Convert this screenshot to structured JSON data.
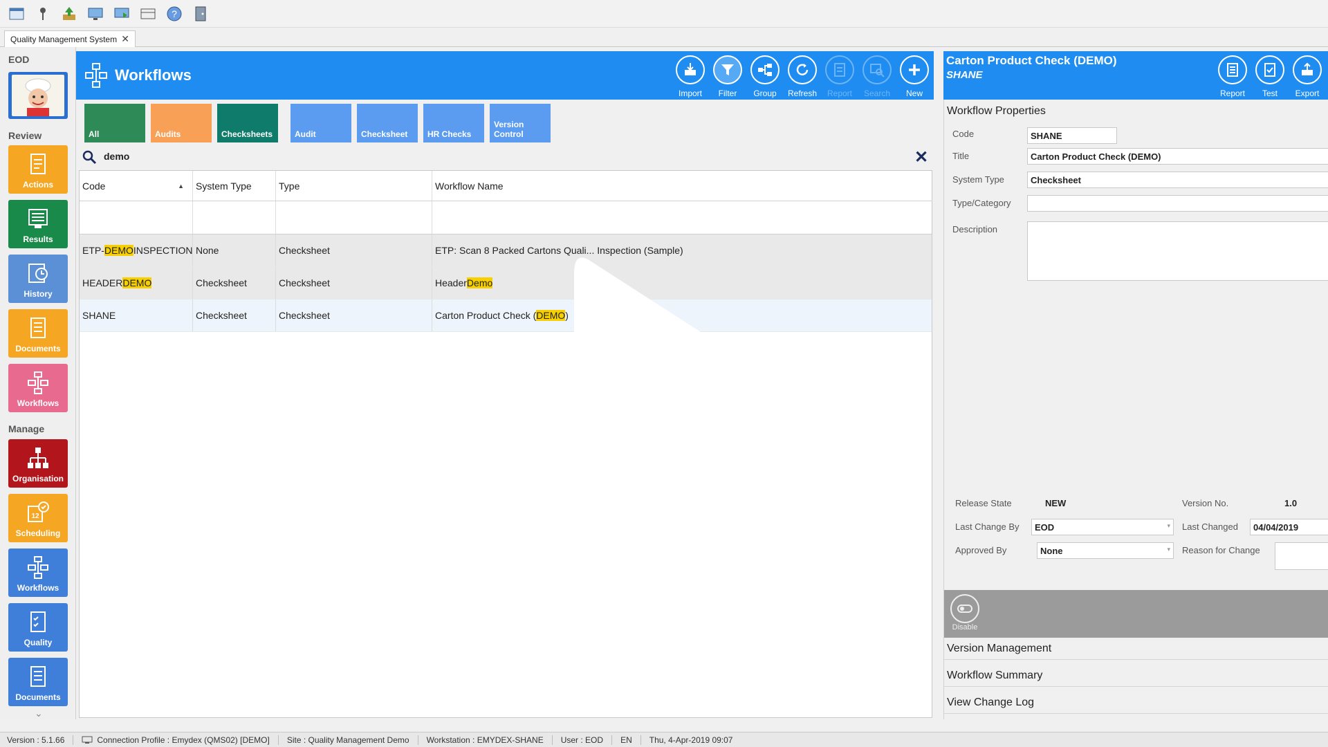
{
  "app": {
    "doc_tab_label": "Quality Management System"
  },
  "leftnav": {
    "user_label": "EOD",
    "review_label": "Review",
    "manage_label": "Manage",
    "review_items": [
      {
        "label": "Actions",
        "color": "#f5a623"
      },
      {
        "label": "Results",
        "color": "#1a8a4a"
      },
      {
        "label": "History",
        "color": "#5b8fd6"
      },
      {
        "label": "Documents",
        "color": "#f5a623"
      },
      {
        "label": "Workflows",
        "color": "#e96a8f"
      }
    ],
    "manage_items": [
      {
        "label": "Organisation",
        "color": "#b3151c"
      },
      {
        "label": "Scheduling",
        "color": "#f5a623"
      },
      {
        "label": "Workflows",
        "color": "#3f7fd9"
      },
      {
        "label": "Quality",
        "color": "#3f7fd9"
      },
      {
        "label": "Documents",
        "color": "#3f7fd9"
      }
    ]
  },
  "workflows": {
    "title": "Workflows",
    "buttons": {
      "import": "Import",
      "filter": "Filter",
      "group": "Group",
      "refresh": "Refresh",
      "report": "Report",
      "search": "Search",
      "new": "New"
    },
    "filter_tiles": [
      {
        "label": "All",
        "color": "#2e8b57"
      },
      {
        "label": "Audits",
        "color": "#f8a055"
      },
      {
        "label": "Checksheets",
        "color": "#0f7c6b"
      },
      {
        "label": "Audit",
        "color": "#5b9bf0"
      },
      {
        "label": "Checksheet",
        "color": "#5b9bf0"
      },
      {
        "label": "HR Checks",
        "color": "#5b9bf0"
      },
      {
        "label": "Version Control",
        "color": "#5b9bf0"
      }
    ],
    "search_text": "demo",
    "columns": [
      "Code",
      "System Type",
      "Type",
      "Workflow Name"
    ],
    "rows": [
      {
        "code_pre": "ETP-",
        "code_hl": "DEMO",
        "code_post": "INSPECTION",
        "system_type": "None",
        "type": "Checksheet",
        "name_pre": "ETP: Scan 8 Packed Cartons Quali... Inspection (Sample)",
        "name_hl": "",
        "name_post": ""
      },
      {
        "code_pre": "HEADER",
        "code_hl": "DEMO",
        "code_post": "",
        "system_type": "Checksheet",
        "type": "Checksheet",
        "name_pre": "Header ",
        "name_hl": "Demo",
        "name_post": ""
      },
      {
        "code_pre": "SHANE",
        "code_hl": "",
        "code_post": "",
        "system_type": "Checksheet",
        "type": "Checksheet",
        "name_pre": "Carton Product Check (",
        "name_hl": "DEMO",
        "name_post": ")"
      }
    ]
  },
  "properties": {
    "header_title": "Carton Product Check (DEMO)",
    "header_subtitle": "SHANE",
    "buttons": {
      "report": "Report",
      "test": "Test",
      "export": "Export"
    },
    "section_title": "Workflow Properties",
    "labels": {
      "code": "Code",
      "title": "Title",
      "system_type": "System Type",
      "type_category": "Type/Category",
      "description": "Description",
      "release_state": "Release State",
      "version_no": "Version No.",
      "last_change_by": "Last Change By",
      "last_changed": "Last Changed",
      "approved_by": "Approved By",
      "reason_for_change": "Reason for Change"
    },
    "values": {
      "code": "SHANE",
      "title": "Carton Product Check (DEMO)",
      "system_type": "Checksheet",
      "type_category": "",
      "description": "",
      "release_state": "NEW",
      "version_no": "1.0",
      "last_change_by": "EOD",
      "last_changed": "04/04/2019",
      "approved_by": "None",
      "reason_for_change": ""
    },
    "disable_label": "Disable",
    "accordion": [
      "Version Management",
      "Workflow Summary",
      "View Change Log"
    ]
  },
  "status": {
    "version": "Version : 5.1.66",
    "connection": "Connection Profile : Emydex (QMS02) [DEMO]",
    "site": "Site : Quality Management Demo",
    "workstation": "Workstation : EMYDEX-SHANE",
    "user": "User : EOD",
    "lang": "EN",
    "datetime": "Thu, 4-Apr-2019 09:07"
  }
}
